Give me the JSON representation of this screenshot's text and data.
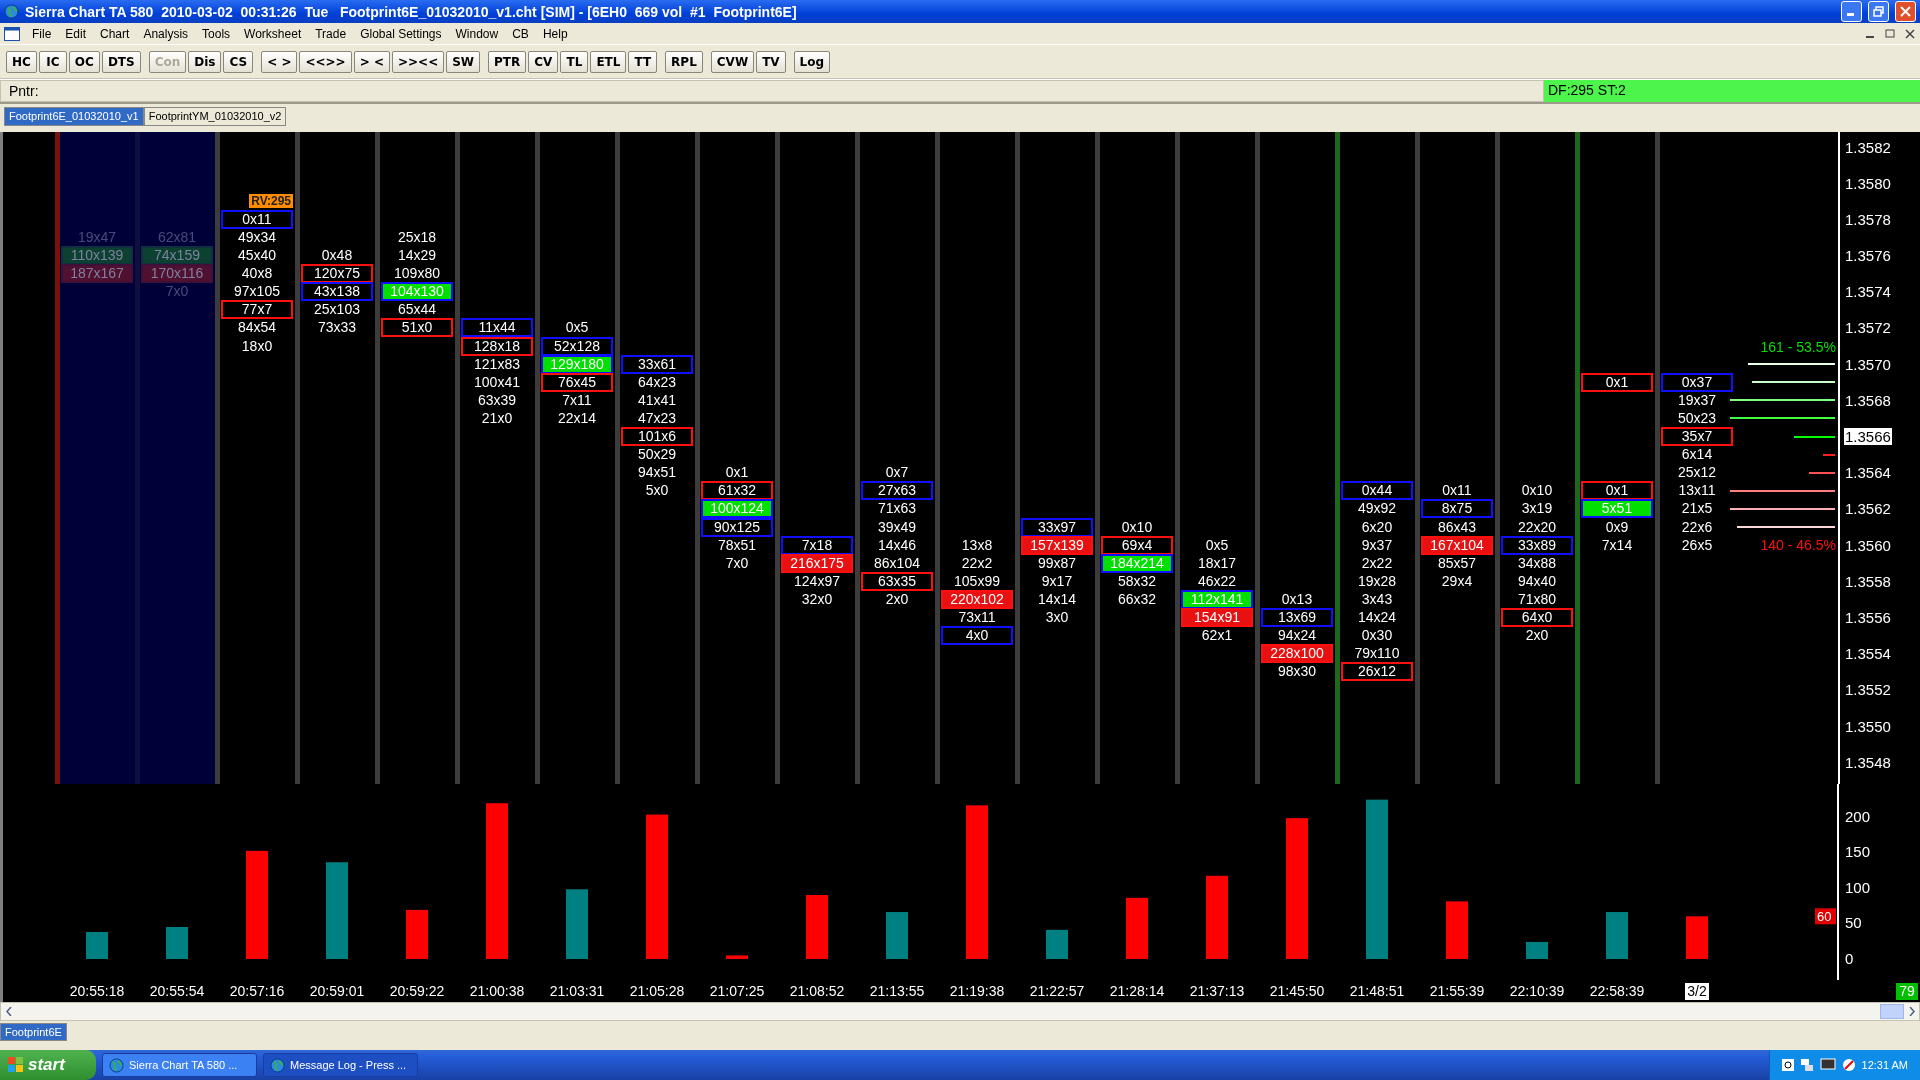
{
  "window": {
    "title": "Sierra Chart TA 580  2010-03-02  00:31:26  Tue   Footprint6E_01032010_v1.cht [SIM] - [6EH0  669 vol  #1  Footprint6E]"
  },
  "menu": [
    "File",
    "Edit",
    "Chart",
    "Analysis",
    "Tools",
    "Worksheet",
    "Trade",
    "Global Settings",
    "Window",
    "CB",
    "Help"
  ],
  "toolbar": [
    [
      {
        "label": "HC",
        "disabled": false
      },
      {
        "label": "IC",
        "disabled": false
      },
      {
        "label": "OC",
        "disabled": false
      },
      {
        "label": "DTS",
        "disabled": false
      }
    ],
    [
      {
        "label": "Con",
        "disabled": true
      },
      {
        "label": "Dis",
        "disabled": false
      },
      {
        "label": "CS",
        "disabled": false
      }
    ],
    [
      {
        "label": "< >",
        "disabled": false
      },
      {
        "label": "<<>>",
        "disabled": false
      },
      {
        "label": "> <",
        "disabled": false
      },
      {
        "label": ">><<",
        "disabled": false
      },
      {
        "label": "SW",
        "disabled": false
      }
    ],
    [
      {
        "label": "PTR",
        "disabled": false
      },
      {
        "label": "CV",
        "disabled": false
      },
      {
        "label": "TL",
        "disabled": false
      },
      {
        "label": "ETL",
        "disabled": false
      },
      {
        "label": "TT",
        "disabled": false
      }
    ],
    [
      {
        "label": "RPL",
        "disabled": false
      }
    ],
    [
      {
        "label": "CVW",
        "disabled": false
      },
      {
        "label": "TV",
        "disabled": false
      }
    ],
    [
      {
        "label": "Log",
        "disabled": false
      }
    ]
  ],
  "pointer_bar": {
    "label": "Pntr:",
    "status": "DF:295  ST:2"
  },
  "chart_tabs": [
    {
      "label": "Footprint6E_01032010_v1",
      "selected": true
    },
    {
      "label": "FootprintYM_01032010_v2",
      "selected": false
    }
  ],
  "columns": [
    {
      "highlighted": true,
      "color": "#7a1010",
      "cells": [
        {
          "text": "19x47",
          "kind": "plain"
        },
        {
          "text": "110x139",
          "kind": "green_fill"
        },
        {
          "text": "187x167",
          "kind": "red_fill"
        }
      ]
    },
    {
      "highlighted": true,
      "color": "#101040",
      "cells": [
        {
          "text": "62x81",
          "kind": "plain"
        },
        {
          "text": "74x159",
          "kind": "green_fill"
        },
        {
          "text": "170x116",
          "kind": "red_fill"
        },
        {
          "text": "7x0",
          "kind": "plain"
        }
      ]
    },
    {
      "highlighted": false,
      "color": "#3c3c3c",
      "label": "RV:295",
      "cells": [
        {
          "text": "0x11",
          "kind": "blue_box"
        },
        {
          "text": "49x34",
          "kind": "plain"
        },
        {
          "text": "45x40",
          "kind": "plain"
        },
        {
          "text": "40x8",
          "kind": "plain"
        },
        {
          "text": "97x105",
          "kind": "plain"
        },
        {
          "text": "77x7",
          "kind": "red_box"
        },
        {
          "text": "84x54",
          "kind": "plain"
        },
        {
          "text": "18x0",
          "kind": "plain"
        }
      ]
    },
    {
      "highlighted": false,
      "color": "#3c3c3c",
      "cells": [
        {
          "text": "0x48",
          "kind": "plain"
        },
        {
          "text": "120x75",
          "kind": "red_box"
        },
        {
          "text": "43x138",
          "kind": "blue_box"
        },
        {
          "text": "25x103",
          "kind": "plain"
        },
        {
          "text": "73x33",
          "kind": "plain"
        }
      ]
    },
    {
      "highlighted": false,
      "color": "#3c3c3c",
      "cells": [
        {
          "text": "25x18",
          "kind": "plain"
        },
        {
          "text": "14x29",
          "kind": "plain"
        },
        {
          "text": "109x80",
          "kind": "plain"
        },
        {
          "text": "104x130",
          "kind": "green_fill"
        },
        {
          "text": "65x44",
          "kind": "plain"
        },
        {
          "text": "51x0",
          "kind": "red_box"
        }
      ]
    },
    {
      "highlighted": false,
      "color": "#3c3c3c",
      "cells": [
        {
          "text": "11x44",
          "kind": "blue_box"
        },
        {
          "text": "128x18",
          "kind": "red_box"
        },
        {
          "text": "121x83",
          "kind": "plain"
        },
        {
          "text": "100x41",
          "kind": "plain"
        },
        {
          "text": "63x39",
          "kind": "plain"
        },
        {
          "text": "21x0",
          "kind": "plain"
        }
      ]
    },
    {
      "highlighted": false,
      "color": "#3c3c3c",
      "cells": [
        {
          "text": "0x5",
          "kind": "plain"
        },
        {
          "text": "52x128",
          "kind": "blue_box"
        },
        {
          "text": "129x180",
          "kind": "green_fill"
        },
        {
          "text": "76x45",
          "kind": "red_box"
        },
        {
          "text": "7x11",
          "kind": "plain"
        },
        {
          "text": "22x14",
          "kind": "plain"
        }
      ]
    },
    {
      "highlighted": false,
      "color": "#3c3c3c",
      "cells": [
        {
          "text": "33x61",
          "kind": "blue_box"
        },
        {
          "text": "64x23",
          "kind": "plain"
        },
        {
          "text": "41x41",
          "kind": "plain"
        },
        {
          "text": "47x23",
          "kind": "plain"
        },
        {
          "text": "101x6",
          "kind": "red_box"
        },
        {
          "text": "50x29",
          "kind": "plain"
        },
        {
          "text": "94x51",
          "kind": "plain"
        },
        {
          "text": "5x0",
          "kind": "plain"
        }
      ]
    },
    {
      "highlighted": false,
      "color": "#3c3c3c",
      "cells": [
        {
          "text": "0x1",
          "kind": "plain"
        },
        {
          "text": "61x32",
          "kind": "red_box"
        },
        {
          "text": "100x124",
          "kind": "green_fill"
        },
        {
          "text": "90x125",
          "kind": "blue_box"
        },
        {
          "text": "78x51",
          "kind": "plain"
        },
        {
          "text": "7x0",
          "kind": "plain"
        }
      ]
    },
    {
      "highlighted": false,
      "color": "#3c3c3c",
      "cells": [
        {
          "text": "7x18",
          "kind": "blue_box"
        },
        {
          "text": "216x175",
          "kind": "red_fill"
        },
        {
          "text": "124x97",
          "kind": "plain"
        },
        {
          "text": "32x0",
          "kind": "plain"
        }
      ]
    },
    {
      "highlighted": false,
      "color": "#3c3c3c",
      "cells": [
        {
          "text": "0x7",
          "kind": "plain"
        },
        {
          "text": "27x63",
          "kind": "blue_box"
        },
        {
          "text": "71x63",
          "kind": "plain"
        },
        {
          "text": "39x49",
          "kind": "plain"
        },
        {
          "text": "14x46",
          "kind": "plain"
        },
        {
          "text": "86x104",
          "kind": "plain"
        },
        {
          "text": "63x35",
          "kind": "red_box"
        },
        {
          "text": "2x0",
          "kind": "plain"
        }
      ]
    },
    {
      "highlighted": false,
      "color": "#3c3c3c",
      "cells": [
        {
          "text": "13x8",
          "kind": "plain"
        },
        {
          "text": "22x2",
          "kind": "plain"
        },
        {
          "text": "105x99",
          "kind": "plain"
        },
        {
          "text": "220x102",
          "kind": "red_fill"
        },
        {
          "text": "73x11",
          "kind": "plain"
        },
        {
          "text": "4x0",
          "kind": "blue_box"
        }
      ]
    },
    {
      "highlighted": false,
      "color": "#3c3c3c",
      "cells": [
        {
          "text": "33x97",
          "kind": "blue_box"
        },
        {
          "text": "157x139",
          "kind": "red_fill"
        },
        {
          "text": "99x87",
          "kind": "plain"
        },
        {
          "text": "9x17",
          "kind": "plain"
        },
        {
          "text": "14x14",
          "kind": "plain"
        },
        {
          "text": "3x0",
          "kind": "plain"
        }
      ]
    },
    {
      "highlighted": false,
      "color": "#3c3c3c",
      "cells": [
        {
          "text": "0x10",
          "kind": "plain"
        },
        {
          "text": "69x4",
          "kind": "red_box"
        },
        {
          "text": "184x214",
          "kind": "green_fill"
        },
        {
          "text": "58x32",
          "kind": "plain"
        },
        {
          "text": "66x32",
          "kind": "plain"
        }
      ]
    },
    {
      "highlighted": false,
      "color": "#3c3c3c",
      "cells": [
        {
          "text": "0x5",
          "kind": "plain"
        },
        {
          "text": "18x17",
          "kind": "plain"
        },
        {
          "text": "46x22",
          "kind": "plain"
        },
        {
          "text": "112x141",
          "kind": "green_fill"
        },
        {
          "text": "154x91",
          "kind": "red_fill"
        },
        {
          "text": "62x1",
          "kind": "plain"
        }
      ]
    },
    {
      "highlighted": false,
      "color": "#3c3c3c",
      "cells": [
        {
          "text": "0x13",
          "kind": "plain"
        },
        {
          "text": "13x69",
          "kind": "blue_box"
        },
        {
          "text": "94x24",
          "kind": "plain"
        },
        {
          "text": "228x100",
          "kind": "red_fill"
        },
        {
          "text": "98x30",
          "kind": "plain"
        }
      ]
    },
    {
      "highlighted": false,
      "color": "#1a6a1a",
      "cells": [
        {
          "text": "0x44",
          "kind": "blue_box"
        },
        {
          "text": "49x92",
          "kind": "plain"
        },
        {
          "text": "6x20",
          "kind": "plain"
        },
        {
          "text": "9x37",
          "kind": "plain"
        },
        {
          "text": "2x22",
          "kind": "plain"
        },
        {
          "text": "19x28",
          "kind": "plain"
        },
        {
          "text": "3x43",
          "kind": "plain"
        },
        {
          "text": "14x24",
          "kind": "plain"
        },
        {
          "text": "0x30",
          "kind": "plain"
        },
        {
          "text": "79x110",
          "kind": "plain"
        },
        {
          "text": "26x12",
          "kind": "red_box"
        }
      ]
    },
    {
      "highlighted": false,
      "color": "#3c3c3c",
      "cells": [
        {
          "text": "0x11",
          "kind": "plain"
        },
        {
          "text": "8x75",
          "kind": "blue_box"
        },
        {
          "text": "86x43",
          "kind": "plain"
        },
        {
          "text": "167x104",
          "kind": "red_fill"
        },
        {
          "text": "85x57",
          "kind": "plain"
        },
        {
          "text": "29x4",
          "kind": "plain"
        }
      ]
    },
    {
      "highlighted": false,
      "color": "#3c3c3c",
      "cells": [
        {
          "text": "0x10",
          "kind": "plain"
        },
        {
          "text": "3x19",
          "kind": "plain"
        },
        {
          "text": "22x20",
          "kind": "plain"
        },
        {
          "text": "33x89",
          "kind": "blue_box"
        },
        {
          "text": "34x88",
          "kind": "plain"
        },
        {
          "text": "94x40",
          "kind": "plain"
        },
        {
          "text": "71x80",
          "kind": "plain"
        },
        {
          "text": "64x0",
          "kind": "red_box"
        },
        {
          "text": "2x0",
          "kind": "plain"
        }
      ]
    },
    {
      "highlighted": false,
      "color": "#1a6a1a",
      "cells": [
        {
          "text": "0x1",
          "kind": "red_box"
        },
        {
          "text": "0x1",
          "kind": "red_box"
        },
        {
          "text": "5x51",
          "kind": "green_fill"
        },
        {
          "text": "0x9",
          "kind": "plain"
        },
        {
          "text": "7x14",
          "kind": "plain"
        }
      ]
    },
    {
      "highlighted": false,
      "color": "#3c3c3c",
      "cells": [
        {
          "text": "0x37",
          "kind": "blue_box"
        },
        {
          "text": "19x37",
          "kind": "plain"
        },
        {
          "text": "50x23",
          "kind": "plain"
        },
        {
          "text": "35x7",
          "kind": "red_box"
        },
        {
          "text": "6x14",
          "kind": "plain"
        },
        {
          "text": "25x12",
          "kind": "plain"
        },
        {
          "text": "13x11",
          "kind": "plain"
        },
        {
          "text": "21x5",
          "kind": "plain"
        },
        {
          "text": "22x6",
          "kind": "plain"
        },
        {
          "text": "26x5",
          "kind": "plain"
        }
      ]
    }
  ],
  "profile": {
    "ask_summary": "161 - 53.5%",
    "bid_summary": "140 - 46.5%"
  },
  "price_axis": [
    {
      "text": "1.3582",
      "current": false
    },
    {
      "text": "1.3580",
      "current": false
    },
    {
      "text": "1.3578",
      "current": false
    },
    {
      "text": "1.3576",
      "current": false
    },
    {
      "text": "1.3574",
      "current": false
    },
    {
      "text": "1.3572",
      "current": false
    },
    {
      "text": "1.3570",
      "current": false
    },
    {
      "text": "1.3568",
      "current": false
    },
    {
      "text": "1.3566",
      "current": true
    },
    {
      "text": "1.3564",
      "current": false
    },
    {
      "text": "1.3562",
      "current": false
    },
    {
      "text": "1.3560",
      "current": false
    },
    {
      "text": "1.3558",
      "current": false
    },
    {
      "text": "1.3556",
      "current": false
    },
    {
      "text": "1.3554",
      "current": false
    },
    {
      "text": "1.3552",
      "current": false
    },
    {
      "text": "1.3550",
      "current": false
    },
    {
      "text": "1.3548",
      "current": false
    }
  ],
  "volume": {
    "current_value": "60",
    "chart_data": {
      "type": "bar",
      "stacked": true,
      "categories": [
        "20:55:18",
        "20:55:54",
        "20:57:16",
        "20:59:01",
        "20:59:22",
        "21:00:38",
        "21:03:31",
        "21:05:28",
        "21:07:25",
        "21:08:52",
        "21:13:55",
        "21:19:38",
        "21:22:57",
        "21:28:14",
        "21:37:13",
        "21:45:50",
        "21:48:51",
        "21:55:39",
        "22:10:39",
        "22:58:39",
        "3/2"
      ],
      "ylim": [
        0,
        246
      ],
      "yticks": [
        0,
        50,
        100,
        150,
        200
      ],
      "series": [
        {
          "color": "#008080",
          "values": [
            38,
            45,
            null,
            136,
            null,
            null,
            98,
            null,
            null,
            null,
            66,
            null,
            41,
            null,
            null,
            null,
            224,
            null,
            24,
            66,
            null
          ]
        },
        {
          "color": "#ff0000",
          "values": [
            null,
            null,
            152,
            null,
            69,
            219,
            null,
            203,
            5,
            90,
            null,
            216,
            null,
            86,
            117,
            198,
            null,
            81,
            null,
            null,
            60
          ]
        }
      ]
    }
  },
  "date_label_boxed": true,
  "bar_timer": "79",
  "sheet_tabs": [
    {
      "label": "Footprint6E",
      "selected": true
    }
  ],
  "taskbar": {
    "start": "start",
    "tasks": [
      {
        "label": "Sierra Chart TA 580 ...",
        "selected": false
      },
      {
        "label": "Message Log - Press ...",
        "selected": true
      }
    ],
    "clock": "12:31 AM"
  }
}
